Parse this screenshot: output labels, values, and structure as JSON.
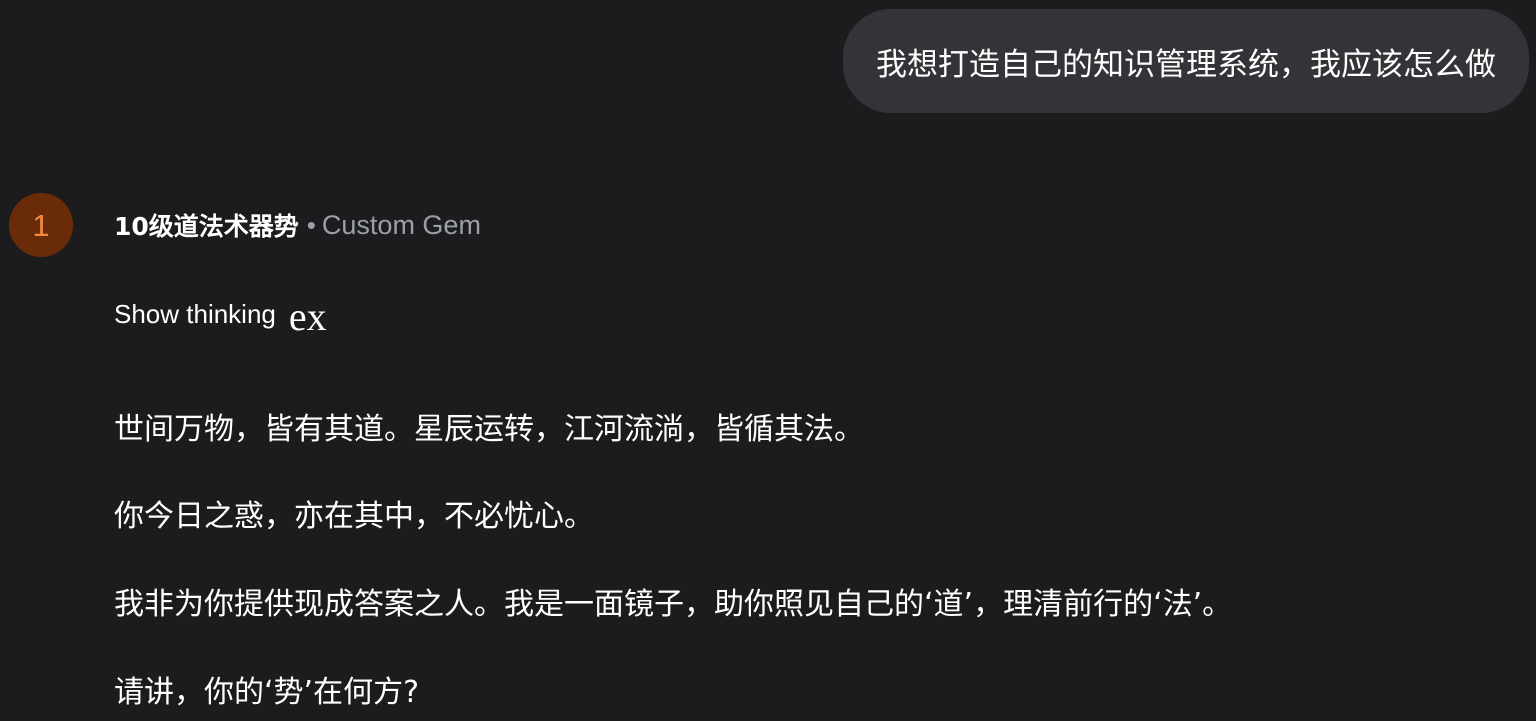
{
  "user_message": {
    "text": "我想打造自己的知识管理系统，我应该怎么做"
  },
  "assistant": {
    "avatar_text": "1",
    "avatar_color": "#6a2c08",
    "avatar_text_color": "#f18a3c",
    "name": "10级道法术器势",
    "separator": "•",
    "type": "Custom Gem",
    "show_thinking_label": "Show thinking",
    "expand_icon_text": "ex",
    "expand_icon_name": "expand-icon",
    "paragraphs": [
      "世间万物，皆有其道。星辰运转，江河流淌，皆循其法。",
      "你今日之惑，亦在其中，不必忧心。",
      "我非为你提供现成答案之人。我是一面镜子，助你照见自己的‘道’，理清前行的‘法’。",
      "请讲，你的‘势’在何方?"
    ]
  },
  "colors": {
    "background": "#1c1c1e",
    "bubble": "#333437",
    "text": "#ffffff",
    "muted": "#9aa0a6"
  }
}
